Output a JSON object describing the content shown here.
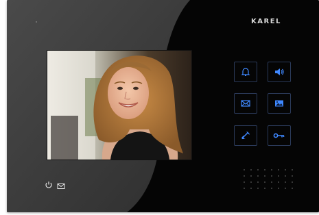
{
  "brand": {
    "logo_text": "KAREL"
  },
  "icons": {
    "bell": "bell-icon",
    "speaker": "speaker-icon",
    "message": "envelope-icon",
    "gallery": "image-icon",
    "call": "handset-icon",
    "door": "key-icon",
    "power": "power-icon",
    "mail_small": "small-envelope-icon"
  },
  "colors": {
    "button_glow": "#3f88ff",
    "panel_gray": "#3b3b3b",
    "panel_black": "#050505",
    "small_icon": "#e8e8e8"
  }
}
